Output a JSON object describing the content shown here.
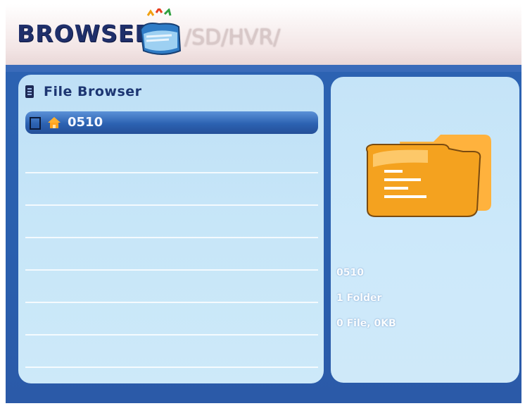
{
  "header": {
    "title": "BROWSER",
    "path": "/SD/HVR/"
  },
  "file_browser": {
    "title": "File Browser",
    "items": [
      {
        "name": "0510",
        "selected": true
      }
    ]
  },
  "details": {
    "name": "0510",
    "folders": "1 Folder",
    "files_size": "0 File,  0KB"
  },
  "colors": {
    "accent_blue": "#2d64b3",
    "folder_orange": "#f4a21f",
    "title_navy": "#1f2f6a"
  }
}
